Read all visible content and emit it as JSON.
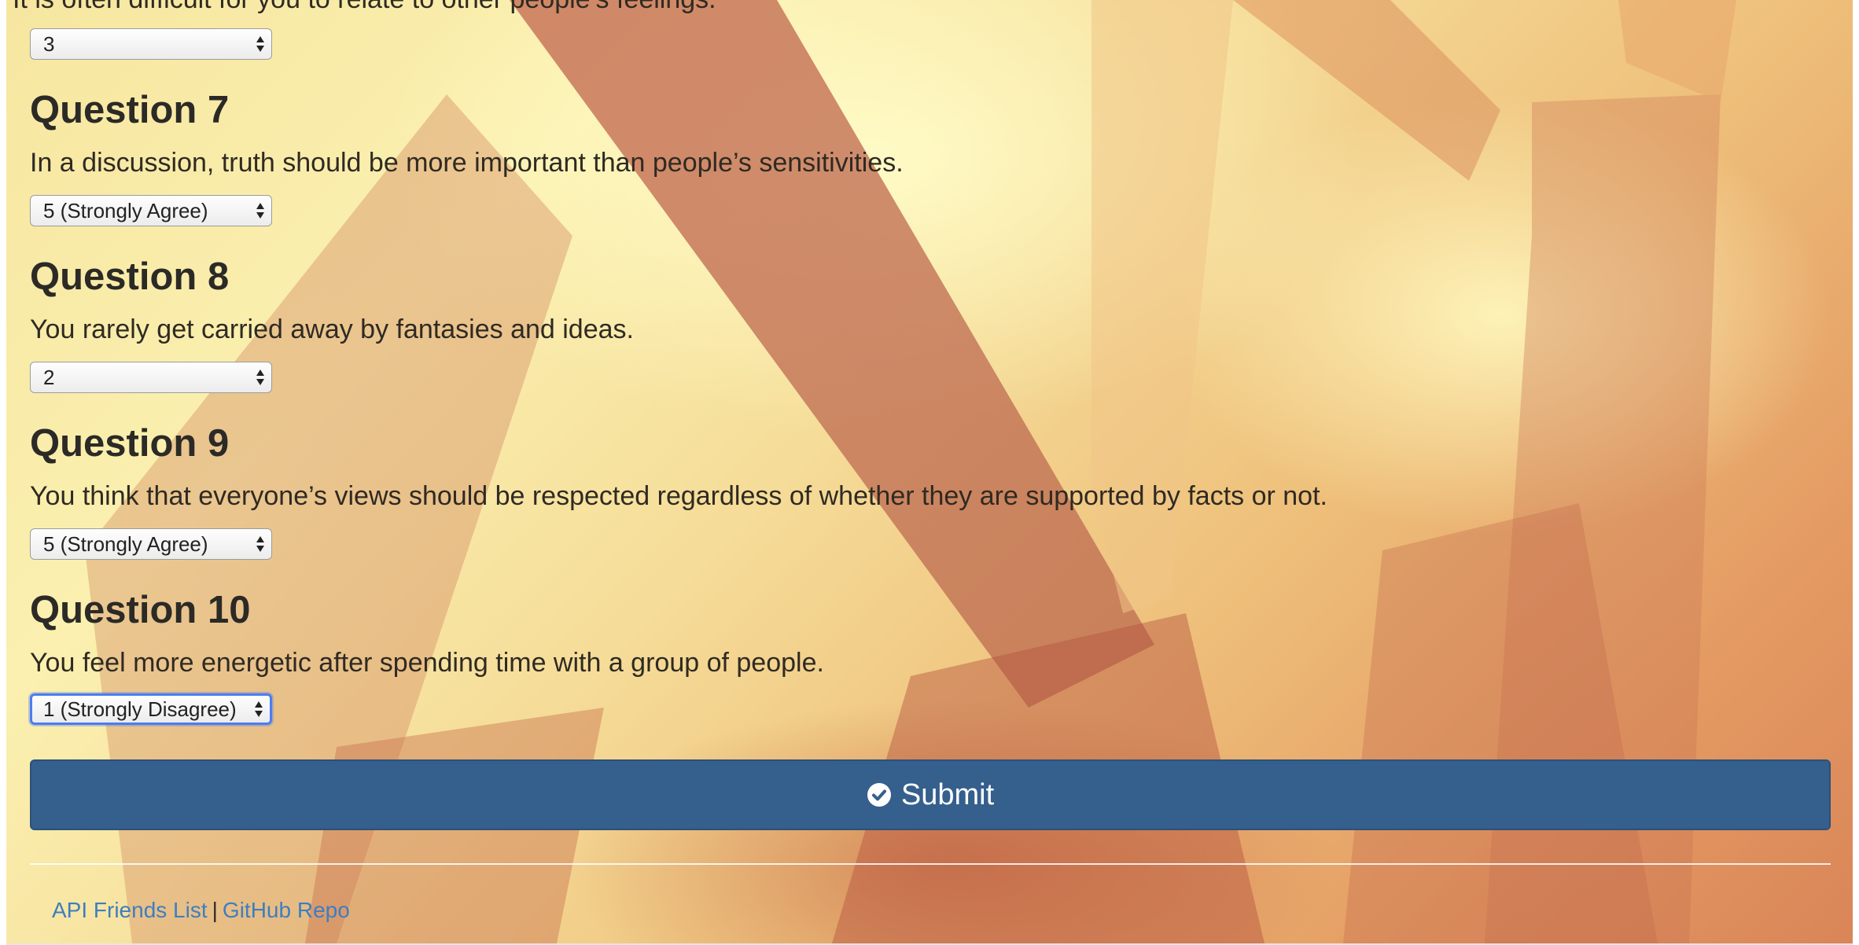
{
  "questions": [
    {
      "text": "It is often difficult for you to relate to other people’s feelings.",
      "selected": "3"
    },
    {
      "title": "Question 7",
      "text": "In a discussion, truth should be more important than people’s sensitivities.",
      "selected": "5 (Strongly Agree)"
    },
    {
      "title": "Question 8",
      "text": "You rarely get carried away by fantasies and ideas.",
      "selected": "2"
    },
    {
      "title": "Question 9",
      "text": "You think that everyone’s views should be respected regardless of whether they are supported by facts or not.",
      "selected": "5 (Strongly Agree)"
    },
    {
      "title": "Question 10",
      "text": "You feel more energetic after spending time with a group of people.",
      "selected": "1 (Strongly Disagree)"
    }
  ],
  "submit": {
    "label": "Submit",
    "icon": "check-circle-icon",
    "color": "#355f8c"
  },
  "footer": {
    "link1": "API Friends List",
    "separator": "|",
    "link2": "GitHub Repo",
    "link_color": "#3d7ec1"
  }
}
